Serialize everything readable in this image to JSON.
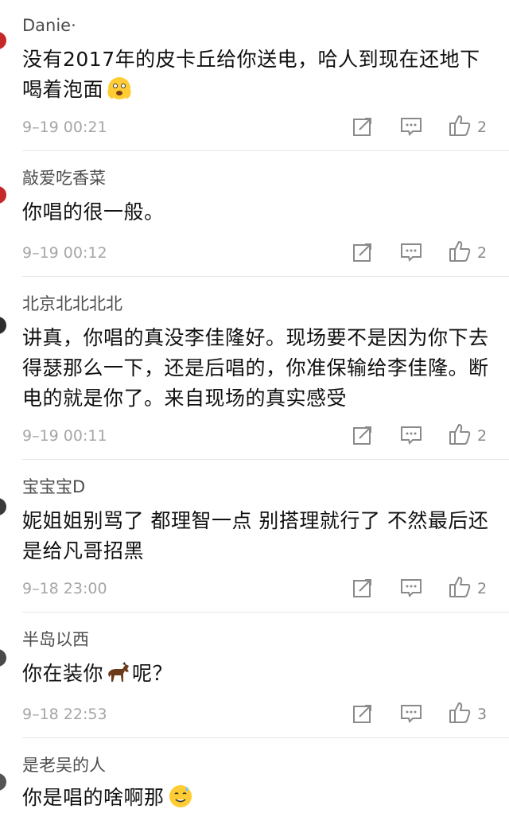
{
  "comments": [
    {
      "username": "Danie·",
      "text": "没有2017年的皮卡丘给你送电，哈人到现在还地下喝着泡面",
      "emoji": "scared-face-emoji",
      "time": "9–19 00:21",
      "likes": "2"
    },
    {
      "username": "敲爱吃香菜",
      "text": "你唱的很一般。",
      "time": "9–19 00:12",
      "likes": "2"
    },
    {
      "username": "北京北北北北",
      "text": "讲真，你唱的真没李佳隆好。现场要不是因为你下去得瑟那么一下，还是后唱的，你准保输给李佳隆。断电的就是你了。来自现场的真实感受",
      "time": "9–19 00:11",
      "likes": "2"
    },
    {
      "username": "宝宝宝D",
      "text": "妮姐姐别骂了 都理智一点 别搭理就行了 不然最后还是给凡哥招黑",
      "time": "9–18 23:00",
      "likes": "2"
    },
    {
      "username": "半岛以西",
      "text_before": "你在装你",
      "text_after": "呢？",
      "emoji": "horse-emoji",
      "time": "9–18 22:53",
      "likes": "3"
    },
    {
      "username": "是老吴的人",
      "text": "你是唱的啥啊那",
      "emoji": "sweat-smile-emoji"
    }
  ],
  "icons": {
    "share": "share-icon",
    "reply": "comment-icon",
    "like": "thumbs-up-icon"
  },
  "colors": {
    "avatar": "#c62828",
    "icon_gray": "#8a8a8a",
    "divider": "#e6e6e6"
  }
}
